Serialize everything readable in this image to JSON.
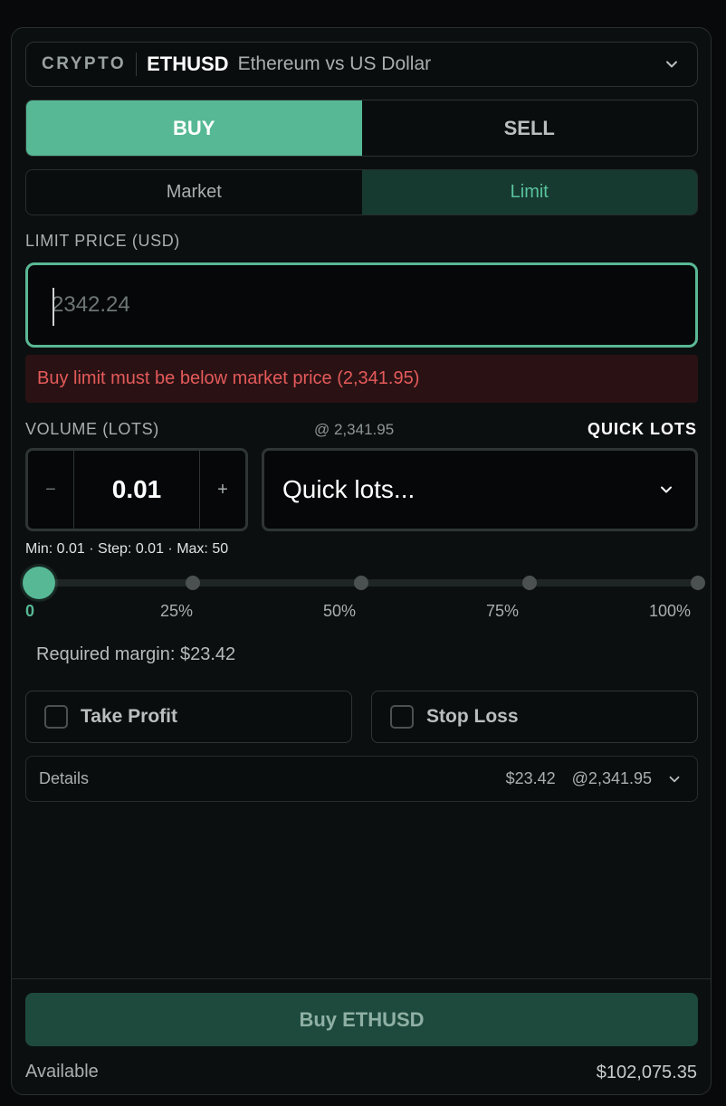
{
  "symbol": {
    "category": "CRYPTO",
    "ticker": "ETHUSD",
    "description": "Ethereum vs US Dollar"
  },
  "side": {
    "buy_label": "BUY",
    "sell_label": "SELL",
    "selected": "buy"
  },
  "order_type": {
    "market_label": "Market",
    "limit_label": "Limit",
    "selected": "limit"
  },
  "limit_price": {
    "label": "LIMIT PRICE (USD)",
    "value": "",
    "placeholder": "2342.24"
  },
  "error_message": "Buy limit must be below market price (2,341.95)",
  "volume": {
    "label": "VOLUME (LOTS)",
    "at_price": "@ 2,341.95",
    "quick_lots_label": "QUICK LOTS",
    "minus_symbol": "−",
    "plus_symbol": "+",
    "value": "0.01",
    "quick_lots_select": "Quick lots...",
    "constraints": "Min: 0.01 · Step: 0.01 · Max: 50"
  },
  "slider": {
    "value_fraction": 0,
    "labels": [
      "0",
      "25%",
      "50%",
      "75%",
      "100%"
    ]
  },
  "required_margin": "Required margin: $23.42",
  "take_profit": {
    "label": "Take Profit",
    "checked": false
  },
  "stop_loss": {
    "label": "Stop Loss",
    "checked": false
  },
  "details": {
    "label": "Details",
    "margin": "$23.42",
    "price": "@2,341.95"
  },
  "submit_label": "Buy ETHUSD",
  "available": {
    "label": "Available",
    "value": "$102,075.35"
  },
  "colors": {
    "accent": "#56b895",
    "error": "#e45a5a",
    "background": "#0c0f10"
  }
}
